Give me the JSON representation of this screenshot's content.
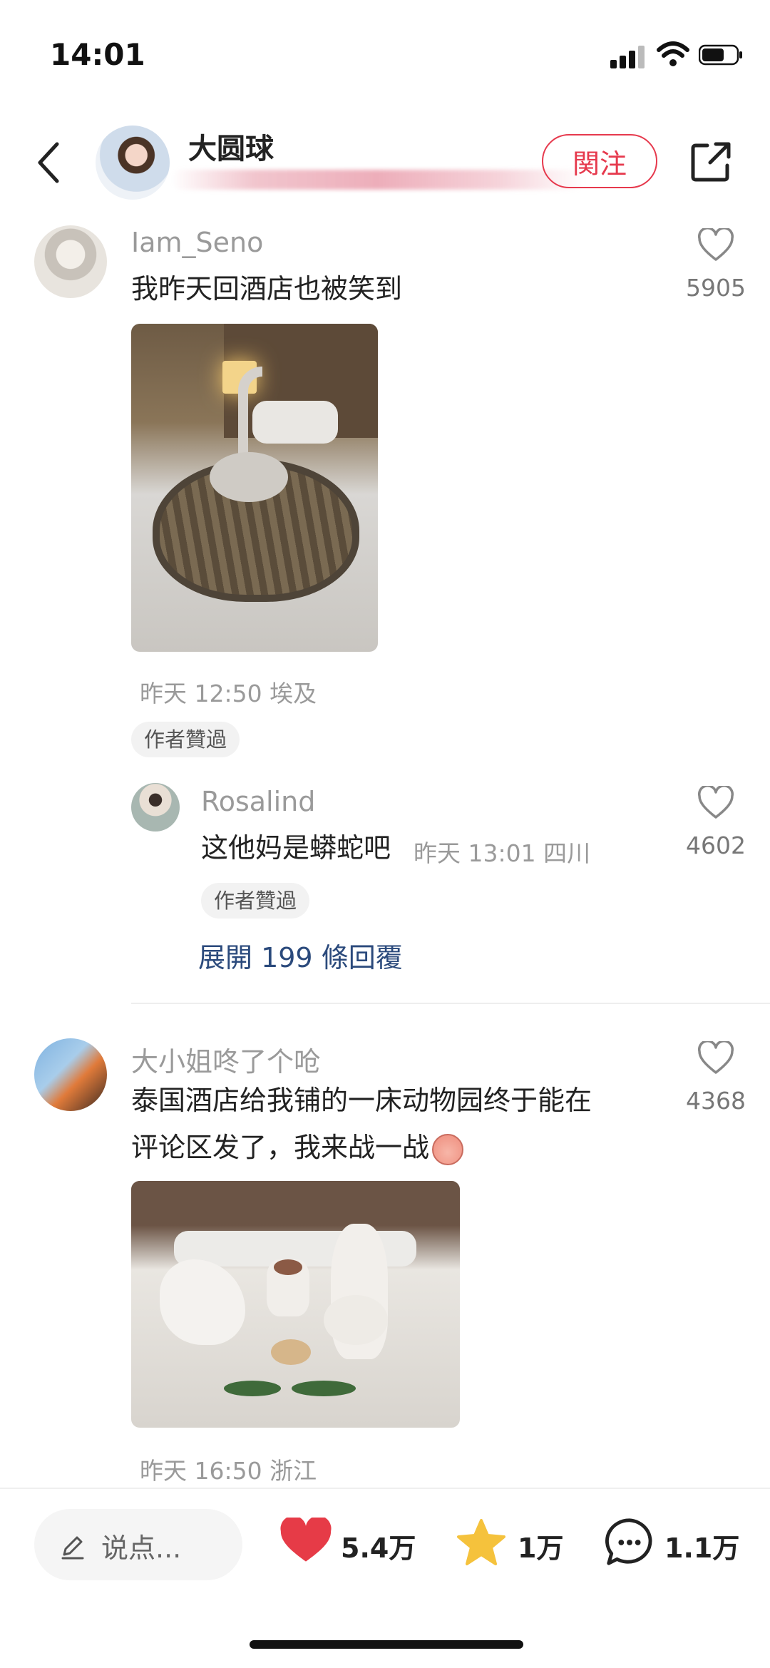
{
  "status_bar": {
    "time": "14:01"
  },
  "header": {
    "author_name": "大圆球",
    "follow_label": "関注"
  },
  "comments": [
    {
      "username": "Iam_Seno",
      "text": "我昨天回酒店也被笑到",
      "likes": "5905",
      "meta": "昨天 12:50 埃及",
      "badge": "作者贊過",
      "reply": {
        "username": "Rosalind",
        "text": "这他妈是蟒蛇吧",
        "meta": "昨天 13:01 四川",
        "likes": "4602",
        "badge": "作者贊過"
      },
      "expand_label": "展開 199 條回覆"
    },
    {
      "username": "大小姐咚了个呛",
      "text_line1": "泰国酒店给我铺的一床动物园终于能在",
      "text_line2": "评论区发了，我来战一战",
      "likes": "4368",
      "meta": "昨天 16:50 浙江"
    }
  ],
  "bottom_bar": {
    "comment_placeholder": "说点...",
    "likes_count": "5.4万",
    "favorites_count": "1万",
    "comments_count": "1.1万"
  },
  "colors": {
    "accent": "#e6394d",
    "like": "#e63b47",
    "star": "#f5c23c",
    "link": "#2b4a7c"
  }
}
